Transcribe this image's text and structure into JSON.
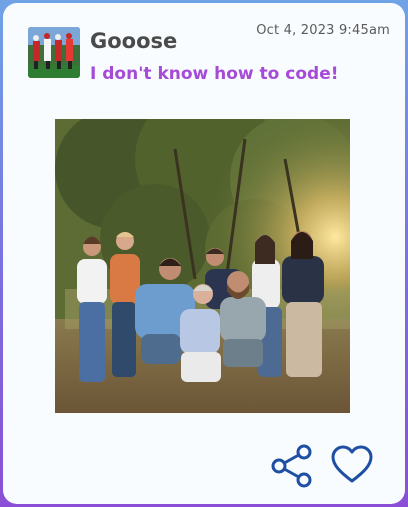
{
  "post": {
    "username": "Gooose",
    "timestamp": "Oct 4, 2023 9:45am",
    "message": "I don't know how to code!"
  },
  "icons": {
    "avatar": "marching-band-photo",
    "share": "share-icon",
    "like": "heart-icon"
  },
  "colors": {
    "username": "#4a4a4a",
    "message": "#a64ad8",
    "icon_stroke": "#1f4fa3",
    "card": "#f8fcff"
  }
}
